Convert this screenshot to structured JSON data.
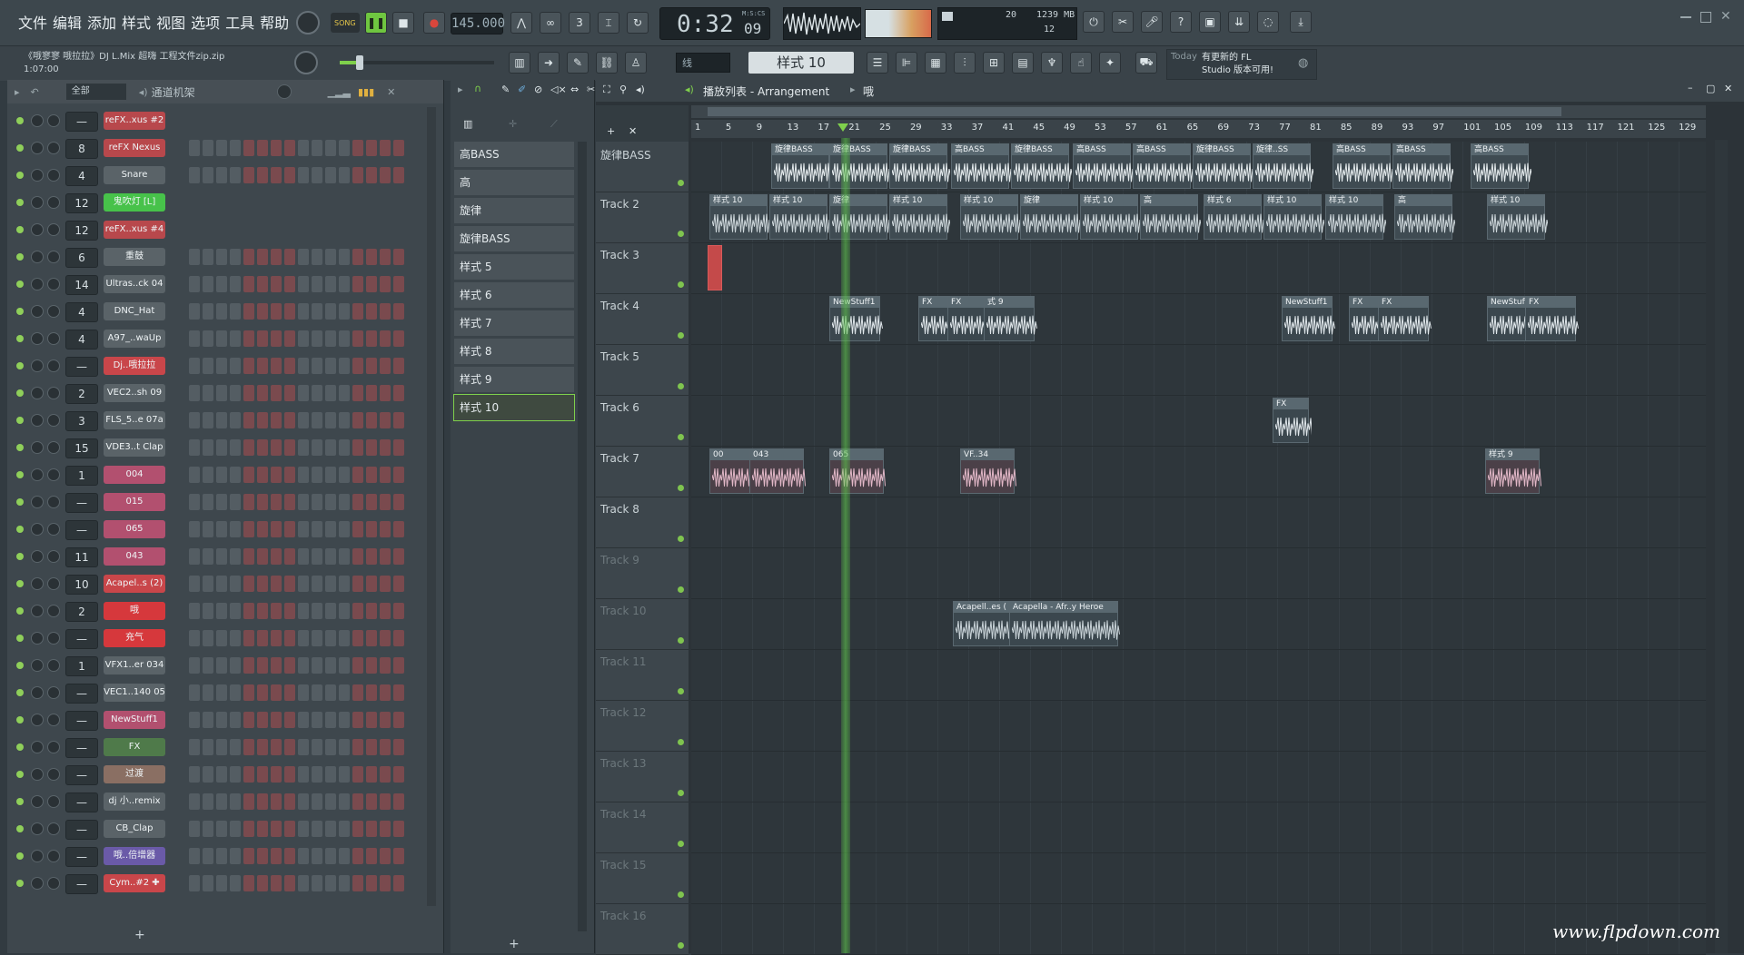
{
  "menu": [
    "文件",
    "编辑",
    "添加",
    "样式",
    "视图",
    "选项",
    "工具",
    "帮助"
  ],
  "transport": {
    "mode": "SONG",
    "tempo": "145.000",
    "time": "0:32",
    "time_frac": "09",
    "time_unit": "M:S:CS",
    "cpu": "20",
    "mem": "1239 MB",
    "poly": "12",
    "pattern_sel": "样式 10"
  },
  "project": {
    "title": "《哦寥寥 哦拉拉》DJ L.Mix 超嗨 工程文件zip.zip",
    "pos": "1:07:00",
    "snap": "线",
    "news_today": "Today",
    "news_text": "有更新的 FL Studio 版本可用!"
  },
  "rack": {
    "filter": "全部",
    "title": "通道机架",
    "add": "+"
  },
  "channels": [
    {
      "num": "—",
      "name": "reFX..xus #2",
      "color": "#b8484c"
    },
    {
      "num": "8",
      "name": "reFX Nexus",
      "color": "#b8484c"
    },
    {
      "num": "4",
      "name": "Snare",
      "color": "#5a6368"
    },
    {
      "num": "12",
      "name": "鬼吹灯 [L]",
      "color": "#47c24a"
    },
    {
      "num": "12",
      "name": "reFX..xus #4",
      "color": "#b8484c"
    },
    {
      "num": "6",
      "name": "重鼓",
      "color": "#5a6368"
    },
    {
      "num": "14",
      "name": "Ultras..ck 04",
      "color": "#5a6368"
    },
    {
      "num": "4",
      "name": "DNC_Hat",
      "color": "#5a6368"
    },
    {
      "num": "4",
      "name": "A97_..waUp",
      "color": "#5a6368"
    },
    {
      "num": "—",
      "name": "Dj..哦拉拉",
      "color": "#c9464a"
    },
    {
      "num": "2",
      "name": "VEC2..sh 09",
      "color": "#5a6368"
    },
    {
      "num": "3",
      "name": "FLS_5..e 07a",
      "color": "#5a6368"
    },
    {
      "num": "15",
      "name": "VDE3..t Clap",
      "color": "#5a6368"
    },
    {
      "num": "1",
      "name": "004",
      "color": "#b2506f"
    },
    {
      "num": "—",
      "name": "015",
      "color": "#b2506f"
    },
    {
      "num": "—",
      "name": "065",
      "color": "#b2506f"
    },
    {
      "num": "11",
      "name": "043",
      "color": "#b2506f"
    },
    {
      "num": "10",
      "name": "Acapel..s (2)",
      "color": "#c9464a"
    },
    {
      "num": "2",
      "name": "哦",
      "color": "#d6383c"
    },
    {
      "num": "—",
      "name": "充气",
      "color": "#d6383c"
    },
    {
      "num": "1",
      "name": "VFX1..er 034",
      "color": "#5a6368"
    },
    {
      "num": "—",
      "name": "VEC1..140 05",
      "color": "#5a6368"
    },
    {
      "num": "—",
      "name": "NewStuff1",
      "color": "#b2506f"
    },
    {
      "num": "—",
      "name": "FX",
      "color": "#4f7a4a"
    },
    {
      "num": "—",
      "name": "过渡",
      "color": "#8a6f63"
    },
    {
      "num": "—",
      "name": "dj 小..remix",
      "color": "#5a6368"
    },
    {
      "num": "—",
      "name": "CB_Clap",
      "color": "#5a6368"
    },
    {
      "num": "—",
      "name": "哦..倍增器",
      "color": "#6a5aa8"
    },
    {
      "num": "—",
      "name": "Cym..#2 ✚",
      "color": "#c9464a"
    }
  ],
  "patterns": [
    "高BASS",
    "高",
    "旋律",
    "旋律BASS",
    "样式 5",
    "样式 6",
    "样式 7",
    "样式 8",
    "样式 9",
    "样式 10"
  ],
  "playlist": {
    "title": "播放列表 - Arrangement",
    "crumb": "哦",
    "ruler": [
      "1",
      "5",
      "9",
      "13",
      "17",
      "21",
      "25",
      "29",
      "33",
      "37",
      "41",
      "45",
      "49",
      "53",
      "57",
      "61",
      "65",
      "69",
      "73",
      "77",
      "81",
      "85",
      "89",
      "93",
      "97",
      "101",
      "105",
      "109",
      "113",
      "117",
      "121",
      "125",
      "129"
    ],
    "tracks": [
      "旋律BASS",
      "Track 2",
      "Track 3",
      "Track 4",
      "Track 5",
      "Track 6",
      "Track 7",
      "Track 8",
      "Track 9",
      "Track 10",
      "Track 11",
      "Track 12",
      "Track 13",
      "Track 14",
      "Track 15",
      "Track 16"
    ]
  },
  "clips": {
    "t1": [
      "旋律BASS",
      "旋律BASS",
      "旋律BASS",
      "高BASS",
      "旋律BASS",
      "高BASS",
      "高BASS",
      "旋律BASS",
      "旋律..SS",
      "高BASS",
      "高BASS",
      "高BASS"
    ],
    "t2": [
      "样式 10",
      "样式 10",
      "旋律",
      "样式 10",
      "样式 10",
      "旋律",
      "样式 10",
      "高",
      "样式 6",
      "样式 10",
      "样式 10",
      "高",
      "样式 10"
    ],
    "t4": [
      "NewStuff1",
      "FX",
      "FX",
      "式 9",
      "NewStuff1",
      "FX",
      "FX",
      "NewStuff1",
      "FX"
    ],
    "t6": [
      "FX"
    ],
    "t7": [
      "00",
      "043",
      "065",
      "VF..34",
      "样式 9"
    ],
    "t10": [
      "Acapell..es (",
      "Acapella - Afr..y Heroe"
    ]
  },
  "watermark": "www.flpdown.com",
  "colors": {
    "accent": "#7fd04c",
    "playhead": "#5cc24a"
  }
}
